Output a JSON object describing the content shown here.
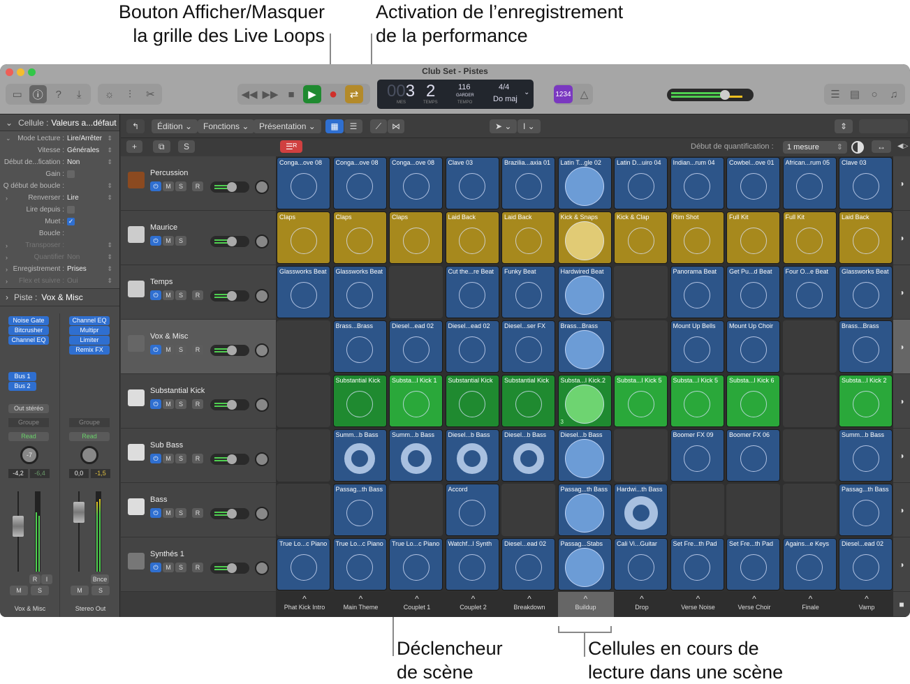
{
  "callouts": {
    "grid_toggle": [
      "Bouton Afficher/Masquer",
      "la grille des Live Loops"
    ],
    "perf_record": [
      "Activation de l’enregistrement",
      "de la performance"
    ],
    "scene_trigger": [
      "Déclencheur",
      "de scène"
    ],
    "playing_cells": [
      "Cellules en cours de",
      "lecture dans une scène"
    ]
  },
  "window": {
    "title": "Club Set - Pistes"
  },
  "lcd": {
    "bars_dim": "00",
    "bars": "3",
    "beat": "2",
    "bars_label": "MES",
    "beat_label": "TEMPS",
    "tempo": "116",
    "tempo_mode": "GARDER",
    "tempo_label": "TEMPO",
    "signature": "4/4",
    "key": "Do maj"
  },
  "count_in": "1234",
  "toolbar": {
    "edit": "Édition",
    "functions": "Fonctions",
    "view": "Présentation"
  },
  "quantize": {
    "label": "Début de quantification :",
    "value": "1 mesure"
  },
  "inspector": {
    "header_label": "Cellule :",
    "header_value": "Valeurs a...défaut",
    "rows": [
      {
        "label": "Mode Lecture :",
        "value": "Lire/Arrêter"
      },
      {
        "label": "Vitesse :",
        "value": "Générales"
      },
      {
        "label": "Début de...fication :",
        "value": "Non"
      },
      {
        "label": "Gain :",
        "value": ""
      },
      {
        "label": "Q début de boucle :",
        "value": ""
      },
      {
        "label": "Renverser :",
        "value": "Lire"
      },
      {
        "label": "Lire depuis :",
        "value": ""
      },
      {
        "label": "Muet :",
        "value": "✓"
      },
      {
        "label": "Boucle :",
        "value": ""
      },
      {
        "label": "Transposer :",
        "value": ""
      },
      {
        "label": "Quantifier",
        "value": "Non"
      },
      {
        "label": "Enregistrement :",
        "value": "Prises"
      },
      {
        "label": "Flex et suivre :",
        "value": "Oui"
      }
    ],
    "track_label": "Piste :",
    "track_value": "Vox & Misc"
  },
  "channel_strips": [
    {
      "name": "Vox & Misc",
      "plugins": [
        "Noise Gate",
        "Bitcrusher",
        "Channel EQ"
      ],
      "sends": [
        "Bus 1",
        "Bus 2"
      ],
      "output": "Out stéréo",
      "group": "Groupe",
      "automation": "Read",
      "pan": "-7",
      "volume": "-4,2",
      "peak": "-6,4",
      "ri": [
        "R",
        "I"
      ],
      "m": "M",
      "s": "S"
    },
    {
      "name": "Stereo Out",
      "plugins": [
        "Channel EQ",
        "Multipr",
        "Limiter",
        "Remix FX"
      ],
      "group": "Groupe",
      "automation": "Read",
      "volume": "0,0",
      "peak": "-1,5",
      "bounce": "Bnce",
      "m": "M",
      "s": "S"
    }
  ],
  "tracks": [
    {
      "name": "Percussion",
      "has_r": true
    },
    {
      "name": "Maurice",
      "has_r": false
    },
    {
      "name": "Temps",
      "has_r": true
    },
    {
      "name": "Vox & Misc",
      "has_r": true
    },
    {
      "name": "Substantial Kick",
      "has_r": true
    },
    {
      "name": "Sub Bass",
      "has_r": true
    },
    {
      "name": "Bass",
      "has_r": true
    },
    {
      "name": "Synthés 1",
      "has_r": true
    }
  ],
  "track_buttons": {
    "m": "M",
    "s": "S",
    "r": "R"
  },
  "cells": [
    [
      "Conga...ove 08",
      "Conga...ove 08",
      "Conga...ove 08",
      "Clave 03",
      "Brazilia...axia 01",
      "Latin T...gle 02",
      "Latin D...uiro 04",
      "Indian...rum 04",
      "Cowbel...ove 01",
      "African...rum 05",
      "Clave 03"
    ],
    [
      "Claps",
      "Claps",
      "Claps",
      "Laid Back",
      "Laid Back",
      "Kick & Snaps",
      "Kick & Clap",
      "Rim Shot",
      "Full Kit",
      "Full Kit",
      "Laid Back"
    ],
    [
      "Glassworks Beat",
      "Glassworks Beat",
      "",
      "Cut the...re Beat",
      "Funky Beat",
      "Hardwired Beat",
      "",
      "Panorama Beat",
      "Get Pu...d Beat",
      "Four O...e Beat",
      "Glassworks Beat"
    ],
    [
      "",
      "Brass...Brass",
      "Diesel...ead 02",
      "Diesel...ead 02",
      "Diesel...ser FX",
      "Brass...Brass",
      "",
      "Mount Up Bells",
      "Mount Up Choir",
      "",
      "Brass...Brass"
    ],
    [
      "",
      "Substantial Kick",
      "Substa...l Kick 1",
      "Substantial Kick",
      "Substantial Kick",
      "Substa...l Kick.2",
      "Substa...l Kick 5",
      "Substa...l Kick 5",
      "Substa...l Kick 6",
      "",
      "Substa...l Kick 2"
    ],
    [
      "",
      "Summ...b Bass",
      "Summ...b Bass",
      "Diesel...b Bass",
      "Diesel...b Bass",
      "Diesel...b Bass",
      "",
      "Boomer FX 09",
      "Boomer FX 06",
      "",
      "Summ...b Bass"
    ],
    [
      "",
      "Passag...th Bass",
      "",
      "Accord",
      "",
      "Passag...th Bass",
      "Hardwi...th Bass",
      "",
      "",
      "",
      "Passag...th Bass"
    ],
    [
      "True Lo...c Piano",
      "True Lo...c Piano",
      "True Lo...c Piano",
      "Watchf...l Synth",
      "Diesel...ead 02",
      "Passag...Stabs",
      "Cali Vi...Guitar",
      "Set Fre...th Pad",
      "Set Fre...th Pad",
      "Agains...e Keys",
      "Diesel...ead 02"
    ]
  ],
  "row_colors": [
    "#2d5589",
    "#a7891d",
    "#2d5589",
    "#2d5589",
    "#1f8a30",
    "#2d5589",
    "#2d5589",
    "#2d5589"
  ],
  "cell_badge": "3",
  "scenes": [
    "Phat Kick Intro",
    "Main Theme",
    "Couplet 1",
    "Couplet 2",
    "Breakdown",
    "Buildup",
    "Drop",
    "Verse Noise",
    "Verse Choir",
    "Finale",
    "Vamp"
  ],
  "active_scene_index": 5
}
